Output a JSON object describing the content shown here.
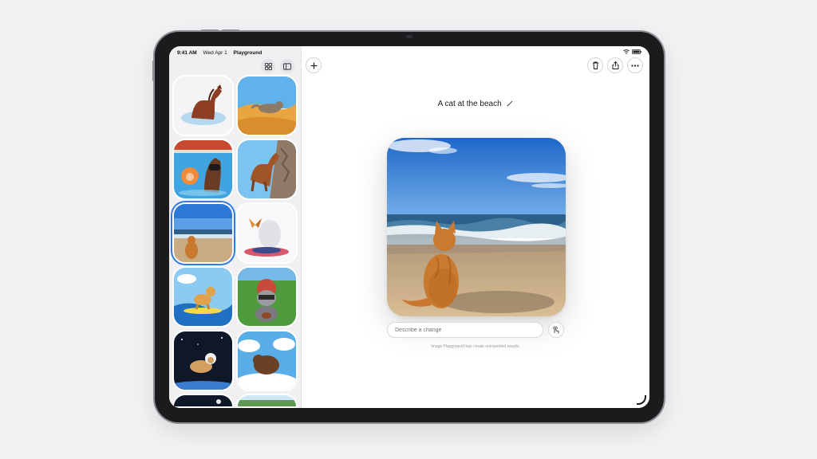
{
  "status_bar": {
    "time": "9:41 AM",
    "date": "Wed Apr 1",
    "app_name": "Playground"
  },
  "sidebar": {
    "tools": [
      {
        "icon": "grid-icon"
      },
      {
        "icon": "sidebar-toggle-icon"
      }
    ],
    "thumbnails": [
      {
        "subject": "horse in water"
      },
      {
        "subject": "cat in desert"
      },
      {
        "subject": "cat and horse at pool"
      },
      {
        "subject": "horse on cliff"
      },
      {
        "subject": "cat at the beach",
        "selected": true
      },
      {
        "subject": "butterfly and geyser"
      },
      {
        "subject": "dog surfing"
      },
      {
        "subject": "raccoon football player"
      },
      {
        "subject": "dog astronaut"
      },
      {
        "subject": "bear in clouds"
      },
      {
        "subject": "space scene"
      },
      {
        "subject": "forest scene"
      }
    ]
  },
  "toolbar": {
    "new_icon": "plus-icon",
    "actions": [
      {
        "icon": "trash-icon"
      },
      {
        "icon": "share-icon"
      },
      {
        "icon": "more-icon"
      }
    ]
  },
  "main": {
    "title": "A cat at the beach",
    "describe_placeholder": "Describe a change",
    "disclaimer": "Image Playground may create unexpected results."
  },
  "colors": {
    "accent": "#2f7ce6",
    "background": "#f2f2f4",
    "device_frame": "#1b1b1d"
  }
}
